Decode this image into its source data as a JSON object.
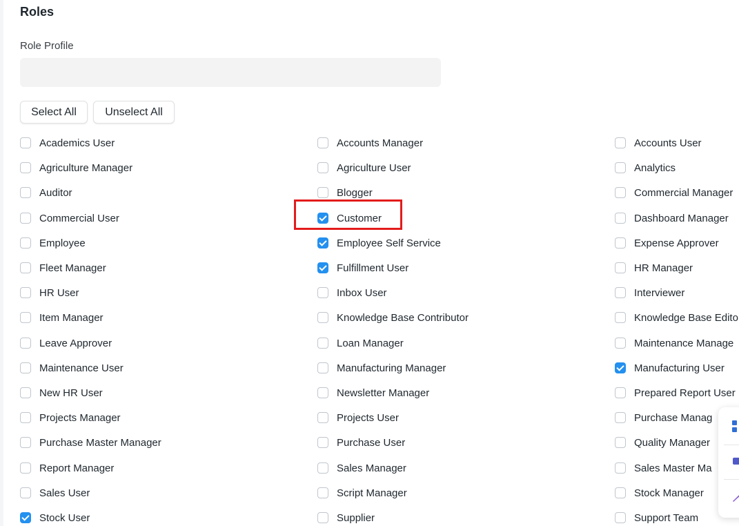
{
  "section": {
    "title": "Roles"
  },
  "role_profile": {
    "label": "Role Profile",
    "value": "",
    "placeholder": ""
  },
  "actions": {
    "select_all": "Select All",
    "unselect_all": "Unselect All"
  },
  "roles": [
    [
      {
        "label": "Academics User",
        "checked": false
      },
      {
        "label": "Accounts Manager",
        "checked": false
      },
      {
        "label": "Accounts User",
        "checked": false
      }
    ],
    [
      {
        "label": "Agriculture Manager",
        "checked": false
      },
      {
        "label": "Agriculture User",
        "checked": false
      },
      {
        "label": "Analytics",
        "checked": false
      }
    ],
    [
      {
        "label": "Auditor",
        "checked": false
      },
      {
        "label": "Blogger",
        "checked": false
      },
      {
        "label": "Commercial Manager",
        "checked": false
      }
    ],
    [
      {
        "label": "Commercial User",
        "checked": false
      },
      {
        "label": "Customer",
        "checked": true
      },
      {
        "label": "Dashboard Manager",
        "checked": false
      }
    ],
    [
      {
        "label": "Employee",
        "checked": false
      },
      {
        "label": "Employee Self Service",
        "checked": true
      },
      {
        "label": "Expense Approver",
        "checked": false
      }
    ],
    [
      {
        "label": "Fleet Manager",
        "checked": false
      },
      {
        "label": "Fulfillment User",
        "checked": true
      },
      {
        "label": "HR Manager",
        "checked": false
      }
    ],
    [
      {
        "label": "HR User",
        "checked": false
      },
      {
        "label": "Inbox User",
        "checked": false
      },
      {
        "label": "Interviewer",
        "checked": false
      }
    ],
    [
      {
        "label": "Item Manager",
        "checked": false
      },
      {
        "label": "Knowledge Base Contributor",
        "checked": false
      },
      {
        "label": "Knowledge Base Edito",
        "checked": false
      }
    ],
    [
      {
        "label": "Leave Approver",
        "checked": false
      },
      {
        "label": "Loan Manager",
        "checked": false
      },
      {
        "label": "Maintenance Manage",
        "checked": false
      }
    ],
    [
      {
        "label": "Maintenance User",
        "checked": false
      },
      {
        "label": "Manufacturing Manager",
        "checked": false
      },
      {
        "label": "Manufacturing User",
        "checked": true
      }
    ],
    [
      {
        "label": "New HR User",
        "checked": false
      },
      {
        "label": "Newsletter Manager",
        "checked": false
      },
      {
        "label": "Prepared Report User",
        "checked": false
      }
    ],
    [
      {
        "label": "Projects Manager",
        "checked": false
      },
      {
        "label": "Projects User",
        "checked": false
      },
      {
        "label": "Purchase Manag",
        "checked": false
      }
    ],
    [
      {
        "label": "Purchase Master Manager",
        "checked": false
      },
      {
        "label": "Purchase User",
        "checked": false
      },
      {
        "label": "Quality Manager",
        "checked": false
      }
    ],
    [
      {
        "label": "Report Manager",
        "checked": false
      },
      {
        "label": "Sales Manager",
        "checked": false
      },
      {
        "label": "Sales Master Ma",
        "checked": false
      }
    ],
    [
      {
        "label": "Sales User",
        "checked": false
      },
      {
        "label": "Script Manager",
        "checked": false
      },
      {
        "label": "Stock Manager",
        "checked": false
      }
    ],
    [
      {
        "label": "Stock User",
        "checked": true
      },
      {
        "label": "Supplier",
        "checked": false
      },
      {
        "label": "Support Team",
        "checked": false
      }
    ]
  ],
  "colors": {
    "checkbox_checked": "#2490ef",
    "highlight": "#e31b1b"
  },
  "floating_panel": {
    "icons": [
      "grid-app-icon",
      "teams-icon",
      "pen-icon"
    ]
  }
}
